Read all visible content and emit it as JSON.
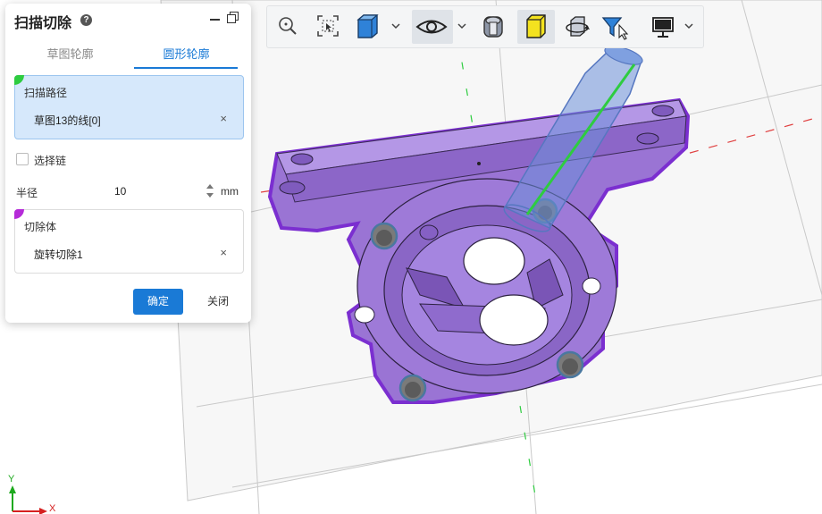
{
  "panel": {
    "title": "扫描切除",
    "tabs": [
      "草图轮廓",
      "圆形轮廓"
    ],
    "active_tab": "圆形轮廓",
    "sweep_path": {
      "label": "扫描路径",
      "value": "草图13的线[0]",
      "clear": "×"
    },
    "select_chain": {
      "label": "选择链",
      "checked": false
    },
    "radius": {
      "label": "半径",
      "value": "10",
      "unit": "mm"
    },
    "cut_body": {
      "label": "切除体",
      "value": "旋转切除1",
      "clear": "×"
    },
    "ok_label": "确定",
    "close_label": "关闭"
  },
  "toolbar": {
    "icons": [
      "zoom-icon",
      "zoom-to-fit-icon",
      "view-cube-icon",
      "visibility-eye-icon",
      "section-view-icon",
      "shaded-display-icon",
      "rotate-view-icon",
      "selection-filter-icon",
      "display-monitor-icon"
    ],
    "active": "visibility-eye-icon"
  },
  "axes": {
    "y": "Y",
    "x": "X"
  },
  "colors": {
    "accent": "#1a7ad6",
    "part_fill": "#9a74d4",
    "highlight": "#7b2fd0",
    "path_line": "#2ecc40",
    "cut_body_mark": "#b52bd8"
  }
}
